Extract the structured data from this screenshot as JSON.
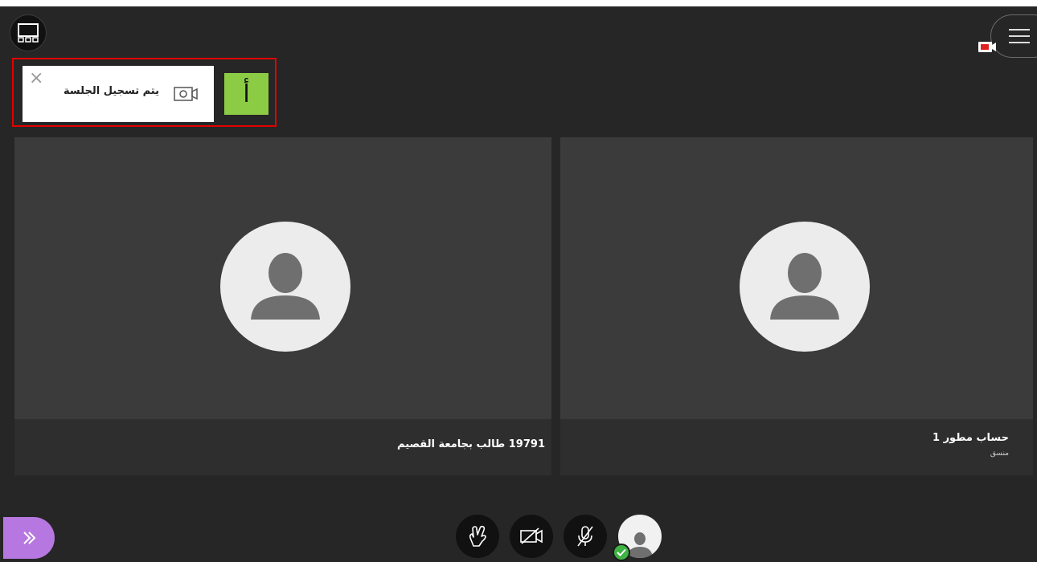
{
  "toast": {
    "message": "يتم تسجيل الجلسة",
    "close_icon": "close-icon",
    "camera_icon": "recording-camera-icon"
  },
  "annotation": {
    "label": "أ",
    "color": "#8ccc45",
    "border_color": "#e30000"
  },
  "participants": [
    {
      "name": "19791 طالب بجامعة القصيم",
      "role": ""
    },
    {
      "name": "حساب مطور 1",
      "role": "منسق"
    }
  ],
  "controls": {
    "hand_icon": "raise-hand-icon",
    "camera_icon": "camera-off-icon",
    "mic_icon": "mic-muted-icon",
    "avatar_icon": "user-avatar-icon",
    "status": "online-check-icon"
  },
  "top_controls": {
    "layout_icon": "layout-grid-icon",
    "menu_icon": "menu-icon",
    "recording_icon": "recording-indicator-icon"
  },
  "panel_toggle": {
    "icon": "double-chevron-right-icon",
    "color": "#b777e0"
  }
}
